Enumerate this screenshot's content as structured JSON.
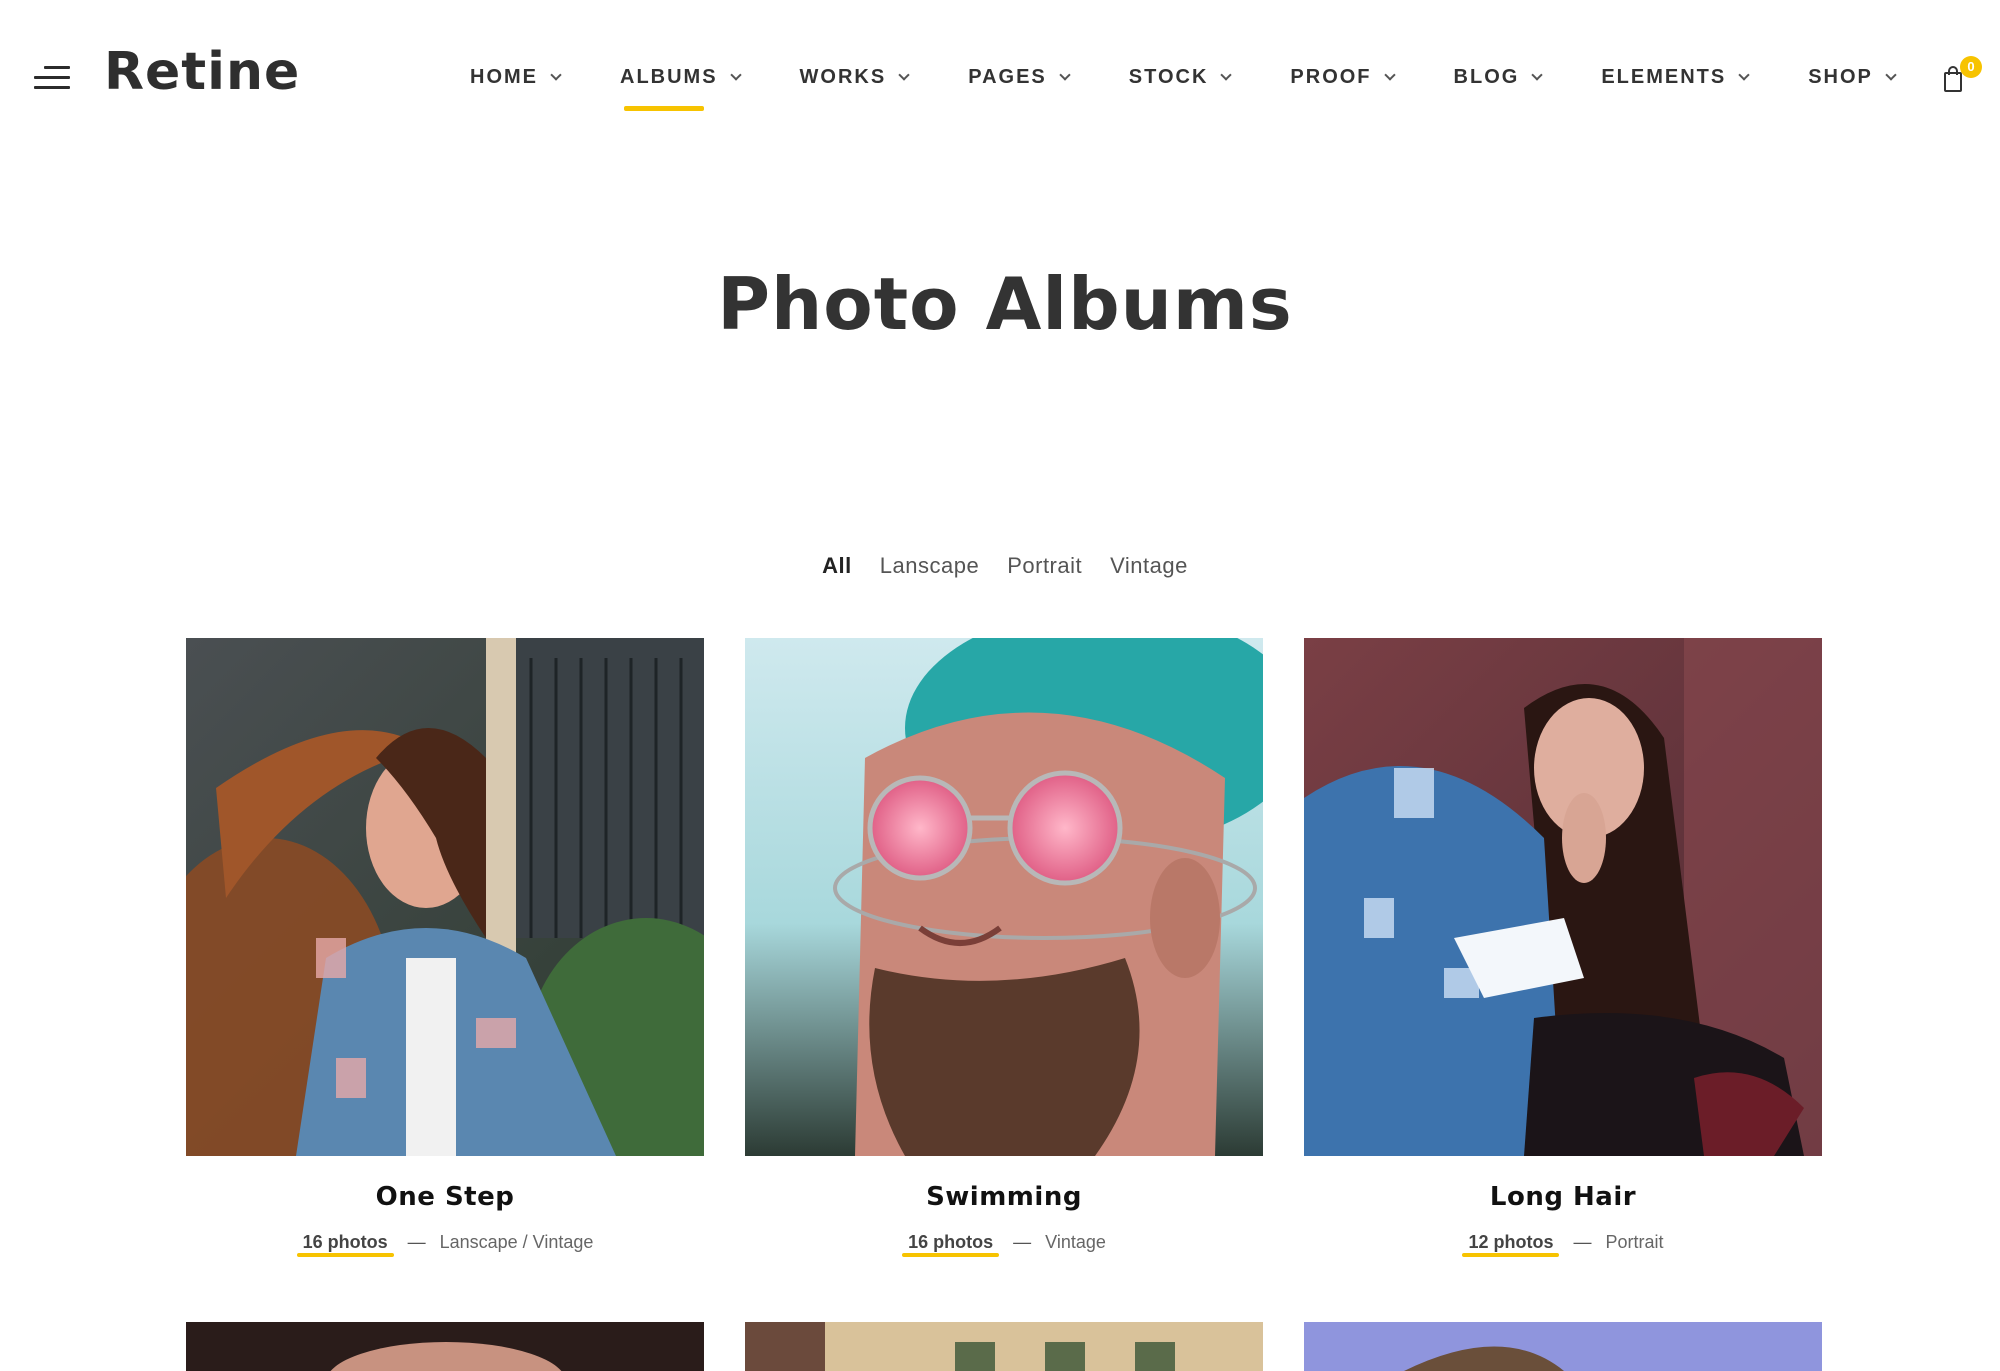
{
  "brand": {
    "logo_text": "Retine"
  },
  "nav": {
    "items": [
      {
        "label": "HOME",
        "active": false
      },
      {
        "label": "ALBUMS",
        "active": true
      },
      {
        "label": "WORKS",
        "active": false
      },
      {
        "label": "PAGES",
        "active": false
      },
      {
        "label": "STOCK",
        "active": false
      },
      {
        "label": "PROOF",
        "active": false
      },
      {
        "label": "BLOG",
        "active": false
      },
      {
        "label": "ELEMENTS",
        "active": false
      },
      {
        "label": "SHOP",
        "active": false
      }
    ]
  },
  "cart": {
    "count": "0",
    "icon": "shopping-bag-icon"
  },
  "page": {
    "title": "Photo Albums"
  },
  "filters": [
    {
      "label": "All",
      "active": true
    },
    {
      "label": "Lanscape",
      "active": false
    },
    {
      "label": "Portrait",
      "active": false
    },
    {
      "label": "Vintage",
      "active": false
    }
  ],
  "albums": [
    {
      "title": "One Step",
      "photos": "16 photos",
      "categories": "Lanscape / Vintage"
    },
    {
      "title": "Swimming",
      "photos": "16 photos",
      "categories": "Vintage"
    },
    {
      "title": "Long Hair",
      "photos": "12 photos",
      "categories": "Portrait"
    }
  ],
  "meta": {
    "separator": "—"
  },
  "colors": {
    "accent": "#f7c300",
    "text": "#333333"
  }
}
